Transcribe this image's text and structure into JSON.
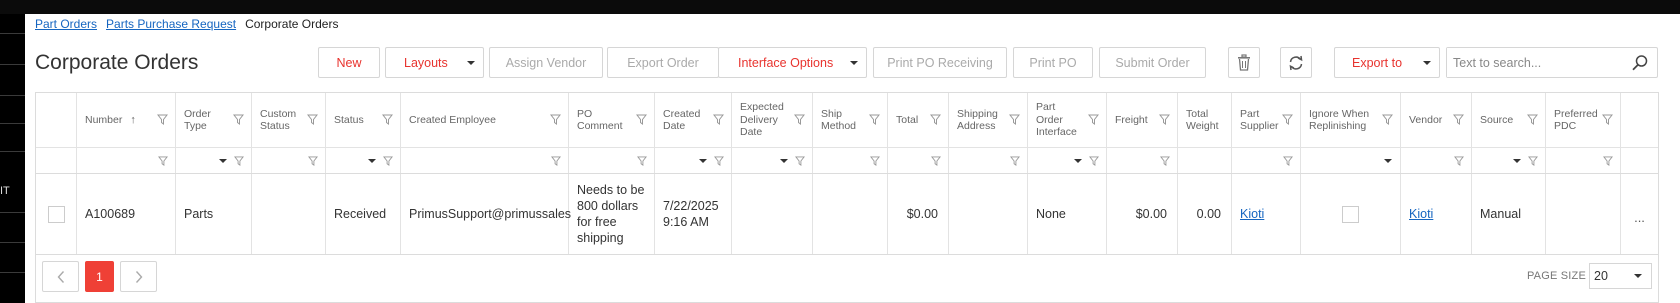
{
  "breadcrumb": [
    {
      "label": "Part Orders",
      "link": true
    },
    {
      "label": "Parts Purchase Request",
      "link": true
    },
    {
      "label": "Corporate Orders",
      "link": false
    }
  ],
  "title": "Corporate Orders",
  "left_nav_text": "IT",
  "toolbar": {
    "new": "New",
    "layouts": "Layouts",
    "assign_vendor": "Assign Vendor",
    "export_order": "Export Order",
    "interface_options": "Interface Options",
    "print_po_receiving": "Print PO Receiving",
    "print_po": "Print PO",
    "submit_order": "Submit Order",
    "export_to": "Export to",
    "search_placeholder": "Text to search...",
    "accent_color": "#e8332e"
  },
  "columns": [
    {
      "key": "select",
      "label": ""
    },
    {
      "key": "number",
      "label": "Number"
    },
    {
      "key": "order_type",
      "label": "Order Type"
    },
    {
      "key": "custom_status",
      "label": "Custom Status"
    },
    {
      "key": "status",
      "label": "Status"
    },
    {
      "key": "created_employee",
      "label": "Created Employee"
    },
    {
      "key": "po_comment",
      "label": "PO Comment"
    },
    {
      "key": "created_date",
      "label": "Created Date"
    },
    {
      "key": "expected_delivery_date",
      "label": "Expected Delivery Date"
    },
    {
      "key": "ship_method",
      "label": "Ship Method"
    },
    {
      "key": "total",
      "label": "Total"
    },
    {
      "key": "shipping_address",
      "label": "Shipping Address"
    },
    {
      "key": "part_order_interface",
      "label": "Part Order Interface"
    },
    {
      "key": "freight",
      "label": "Freight"
    },
    {
      "key": "total_weight",
      "label": "Total Weight"
    },
    {
      "key": "part_supplier",
      "label": "Part Supplier"
    },
    {
      "key": "ignore_when_replinishing",
      "label": "Ignore When Replinishing"
    },
    {
      "key": "vendor",
      "label": "Vendor"
    },
    {
      "key": "source",
      "label": "Source"
    },
    {
      "key": "preferred_pdc",
      "label": "Preferred PDC"
    },
    {
      "key": "actions",
      "label": ""
    }
  ],
  "rows": [
    {
      "number": "A100689",
      "order_type": "Parts",
      "custom_status": "",
      "status": "Received",
      "created_employee": "PrimusSupport@primussales",
      "po_comment": "Needs to be 800 dollars for free shipping",
      "created_date": "7/22/2025 9:16 AM",
      "expected_delivery_date": "",
      "ship_method": "",
      "total": "$0.00",
      "shipping_address": "",
      "part_order_interface": "None",
      "freight": "$0.00",
      "total_weight": "0.00",
      "part_supplier": "Kioti",
      "ignore_when_replinishing": false,
      "vendor": "Kioti",
      "source": "Manual",
      "preferred_pdc": "",
      "actions": "..."
    }
  ],
  "pagination": {
    "current_page": "1",
    "page_size_label": "PAGE SIZE",
    "page_size": "20"
  }
}
